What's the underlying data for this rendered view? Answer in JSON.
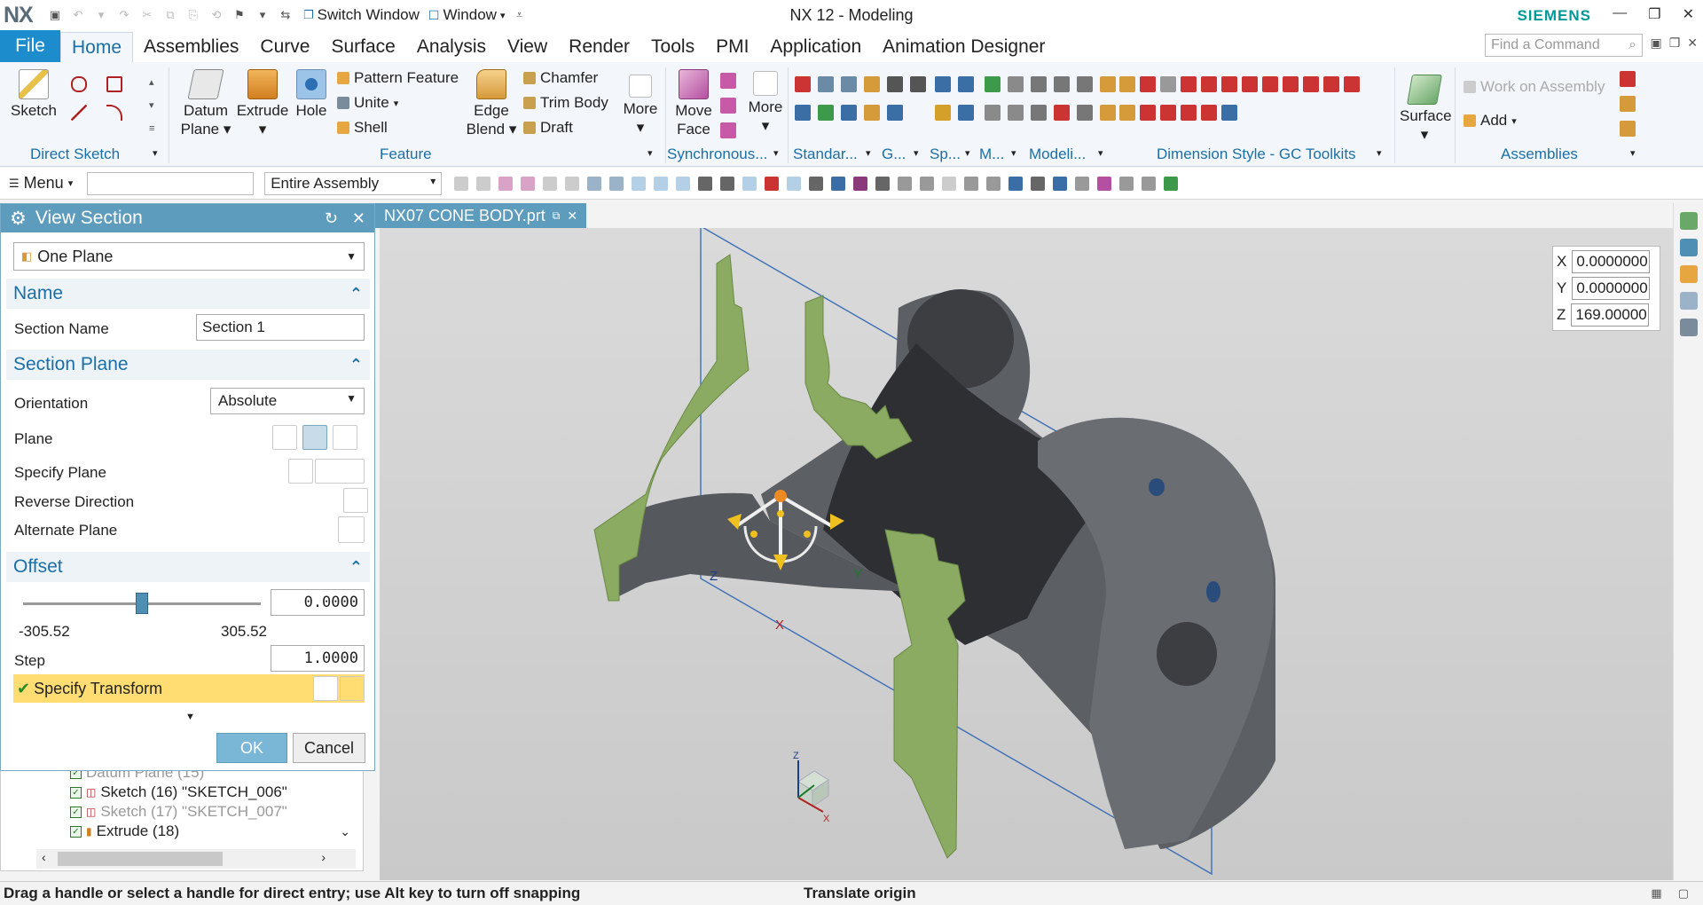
{
  "titlebar": {
    "logo": "NX",
    "switch_window": "Switch Window",
    "window_menu": "Window",
    "title": "NX 12 - Modeling",
    "brand": "SIEMENS"
  },
  "tabs": [
    "File",
    "Home",
    "Assemblies",
    "Curve",
    "Surface",
    "Analysis",
    "View",
    "Render",
    "Tools",
    "PMI",
    "Application",
    "Animation Designer"
  ],
  "active_tab": "Home",
  "command_search_placeholder": "Find a Command",
  "ribbon": {
    "sketch": "Sketch",
    "datum_plane_1": "Datum",
    "datum_plane_2": "Plane",
    "extrude": "Extrude",
    "hole": "Hole",
    "pattern_feature": "Pattern Feature",
    "unite": "Unite",
    "shell": "Shell",
    "edge_blend_1": "Edge",
    "edge_blend_2": "Blend",
    "chamfer": "Chamfer",
    "trim_body": "Trim Body",
    "draft": "Draft",
    "more1": "More",
    "move_face_1": "Move",
    "move_face_2": "Face",
    "more2": "More",
    "surface": "Surface",
    "work_on_assembly": "Work on Assembly",
    "add": "Add",
    "groups": {
      "direct_sketch": "Direct Sketch",
      "feature": "Feature",
      "synchronous": "Synchronous...",
      "standard": "Standar...",
      "g": "G...",
      "sp": "Sp...",
      "m": "M...",
      "modeling": "Modeli...",
      "dimension_style": "Dimension Style - GC Toolkits",
      "assemblies": "Assemblies"
    }
  },
  "cmdbar": {
    "menu": "Menu",
    "filter_scope": "Entire Assembly"
  },
  "dialog": {
    "title": "View Section",
    "type": "One Plane",
    "name_section": "Name",
    "section_name_label": "Section Name",
    "section_name_value": "Section 1",
    "section_plane": "Section Plane",
    "orientation_label": "Orientation",
    "orientation_value": "Absolute",
    "plane_label": "Plane",
    "specify_plane_label": "Specify Plane",
    "reverse_direction": "Reverse Direction",
    "alternate_plane": "Alternate Plane",
    "offset_section": "Offset",
    "offset_value": "0.0000",
    "slider_min": "-305.52",
    "slider_max": "305.52",
    "slider_position_fraction": 0.5,
    "step_label": "Step",
    "step_value": "1.0000",
    "specify_transform": "Specify Transform",
    "ok": "OK",
    "cancel": "Cancel"
  },
  "tree": {
    "rows": [
      {
        "text": "Datum Plane (15)",
        "dim": true
      },
      {
        "text": "Sketch (16) \"SKETCH_006\"",
        "dim": false
      },
      {
        "text": "Sketch (17) \"SKETCH_007\"",
        "dim": true
      },
      {
        "text": "Extrude (18)",
        "dim": false
      }
    ]
  },
  "part_tab": "NX07 CONE BODY.prt",
  "coords": {
    "x_label": "X",
    "x": "0.0000000",
    "y_label": "Y",
    "y": "0.0000000",
    "z_label": "Z",
    "z": "169.00000"
  },
  "handle_labels": {
    "z": "Z",
    "y": "Y",
    "x": "X"
  },
  "triad_labels": {
    "z": "Z",
    "x": "X"
  },
  "status": {
    "left": "Drag a handle or select a handle for direct entry; use Alt key to turn off snapping",
    "mid": "Translate origin"
  },
  "colors": {
    "accent": "#1c8ccc",
    "dialog_header": "#5e9cbd",
    "section_fill": "#8bab63",
    "part_gray": "#5c5f63",
    "highlight": "#ffdd73"
  }
}
